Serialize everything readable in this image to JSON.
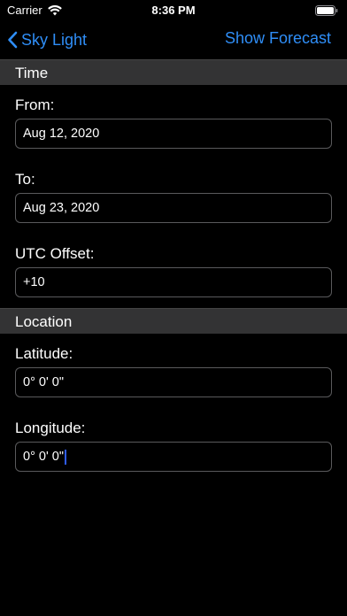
{
  "status_bar": {
    "carrier": "Carrier",
    "time": "8:36 PM"
  },
  "nav": {
    "back_label": "Sky Light",
    "action_label": "Show Forecast"
  },
  "sections": {
    "time": {
      "header": "Time",
      "from_label": "From:",
      "from_value": "Aug 12, 2020",
      "to_label": "To:",
      "to_value": "Aug 23, 2020",
      "utc_label": "UTC Offset:",
      "utc_value": "+10"
    },
    "location": {
      "header": "Location",
      "latitude_label": "Latitude:",
      "latitude_value": "0° 0' 0\"",
      "longitude_label": "Longitude:",
      "longitude_value": "0° 0' 0\""
    }
  },
  "colors": {
    "accent": "#2f8ef7",
    "section_bg": "#333334",
    "background": "#000000"
  }
}
